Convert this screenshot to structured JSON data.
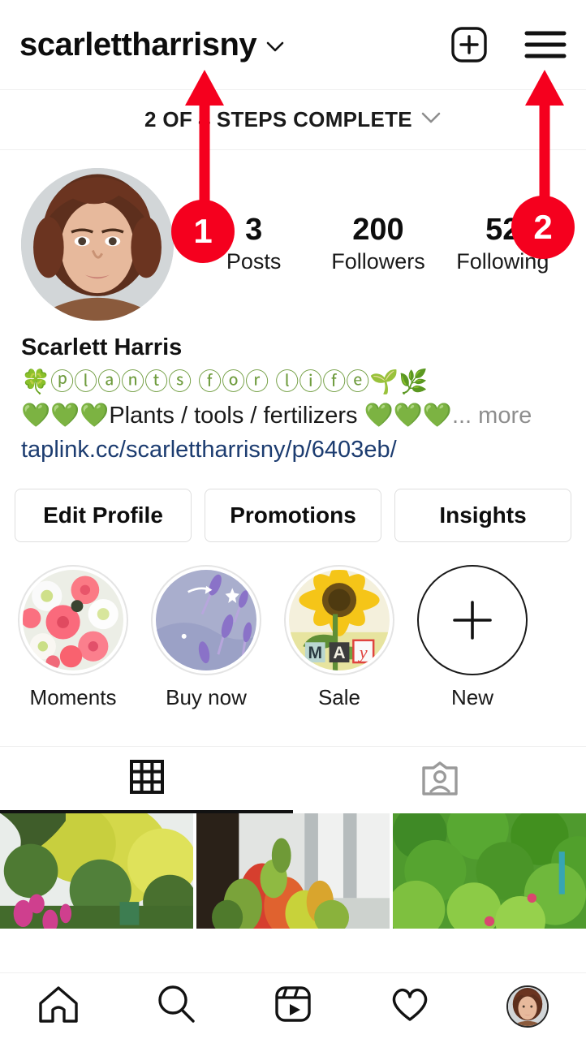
{
  "header": {
    "username": "scarlettharrisny",
    "chevron_icon": "chevron-down-icon",
    "add_icon": "plus-square-icon",
    "menu_icon": "hamburger-menu-icon"
  },
  "steps": {
    "text": "2 OF 4 STEPS COMPLETE",
    "chevron_icon": "chevron-down-icon"
  },
  "profile": {
    "avatar_alt": "Scarlett Harris profile photo",
    "stats": [
      {
        "value": "3",
        "label": "Posts"
      },
      {
        "value": "200",
        "label": "Followers"
      },
      {
        "value": "52",
        "label": "Following"
      }
    ],
    "full_name": "Scarlett Harris",
    "bio_line1": "🍀ⓟⓛⓐⓝⓣⓢ ⓕⓞⓡ ⓛⓘⓕⓔ🌱🌿",
    "bio_line2_hearts_left": "💚💚💚",
    "bio_line2_text": "Plants / tools / fertilizers ",
    "bio_line2_hearts_right": "💚💚💚",
    "bio_more": "... more",
    "link": "taplink.cc/scarlettharrisny/p/6403eb/"
  },
  "actions": [
    {
      "label": "Edit Profile"
    },
    {
      "label": "Promotions"
    },
    {
      "label": "Insights"
    }
  ],
  "highlights": [
    {
      "label": "Moments",
      "icon": "flower-bouquet-thumb"
    },
    {
      "label": "Buy now",
      "icon": "lavender-thumb"
    },
    {
      "label": "Sale",
      "icon": "sunflower-may-thumb"
    },
    {
      "label": "New",
      "icon": "plus-icon"
    }
  ],
  "tabs": [
    {
      "name": "grid",
      "icon": "grid-icon",
      "active": true
    },
    {
      "name": "tagged",
      "icon": "tagged-person-icon",
      "active": false
    }
  ],
  "grid_posts": [
    {
      "alt": "garden with yellow tree and pink flowers"
    },
    {
      "alt": "colorful bromeliad planter by building"
    },
    {
      "alt": "dense green leafy hedge"
    }
  ],
  "bottom_nav": [
    {
      "name": "home",
      "icon": "home-icon"
    },
    {
      "name": "search",
      "icon": "search-icon"
    },
    {
      "name": "reels",
      "icon": "reels-icon"
    },
    {
      "name": "activity",
      "icon": "heart-icon"
    },
    {
      "name": "profile",
      "icon": "profile-avatar-icon"
    }
  ],
  "annotations": {
    "color": "#f5001e",
    "markers": [
      {
        "number": "1",
        "target": "username-dropdown"
      },
      {
        "number": "2",
        "target": "hamburger-menu"
      }
    ]
  }
}
